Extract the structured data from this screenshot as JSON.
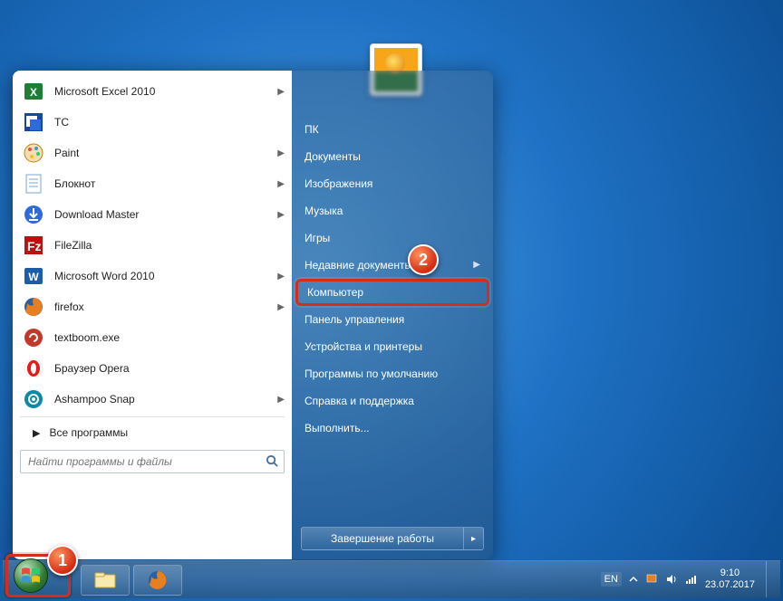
{
  "programs": [
    {
      "name": "Microsoft Excel 2010",
      "icon": "excel",
      "flyout": true
    },
    {
      "name": "TC",
      "icon": "tc",
      "flyout": false
    },
    {
      "name": "Paint",
      "icon": "paint",
      "flyout": true
    },
    {
      "name": "Блокнот",
      "icon": "notepad",
      "flyout": true
    },
    {
      "name": "Download Master",
      "icon": "dm",
      "flyout": true
    },
    {
      "name": "FileZilla",
      "icon": "filezilla",
      "flyout": false
    },
    {
      "name": "Microsoft Word 2010",
      "icon": "word",
      "flyout": true
    },
    {
      "name": "firefox",
      "icon": "firefox",
      "flyout": true
    },
    {
      "name": "textboom.exe",
      "icon": "textboom",
      "flyout": false
    },
    {
      "name": "Браузер Opera",
      "icon": "opera",
      "flyout": false
    },
    {
      "name": "Ashampoo Snap",
      "icon": "snap",
      "flyout": true
    }
  ],
  "all_programs_label": "Все программы",
  "search_placeholder": "Найти программы и файлы",
  "system_items": [
    {
      "label": "ПК",
      "arrow": false
    },
    {
      "label": "Документы",
      "arrow": false
    },
    {
      "label": "Изображения",
      "arrow": false
    },
    {
      "label": "Музыка",
      "arrow": false
    },
    {
      "label": "Игры",
      "arrow": false
    },
    {
      "label": "Недавние документы",
      "arrow": true
    },
    {
      "label": "Компьютер",
      "arrow": false,
      "highlight": true
    },
    {
      "label": "Панель управления",
      "arrow": false
    },
    {
      "label": "Устройства и принтеры",
      "arrow": false
    },
    {
      "label": "Программы по умолчанию",
      "arrow": false
    },
    {
      "label": "Справка и поддержка",
      "arrow": false
    },
    {
      "label": "Выполнить...",
      "arrow": false
    }
  ],
  "shutdown_label": "Завершение работы",
  "tray": {
    "lang": "EN",
    "time": "9:10",
    "date": "23.07.2017"
  },
  "markers": {
    "one": "1",
    "two": "2"
  }
}
